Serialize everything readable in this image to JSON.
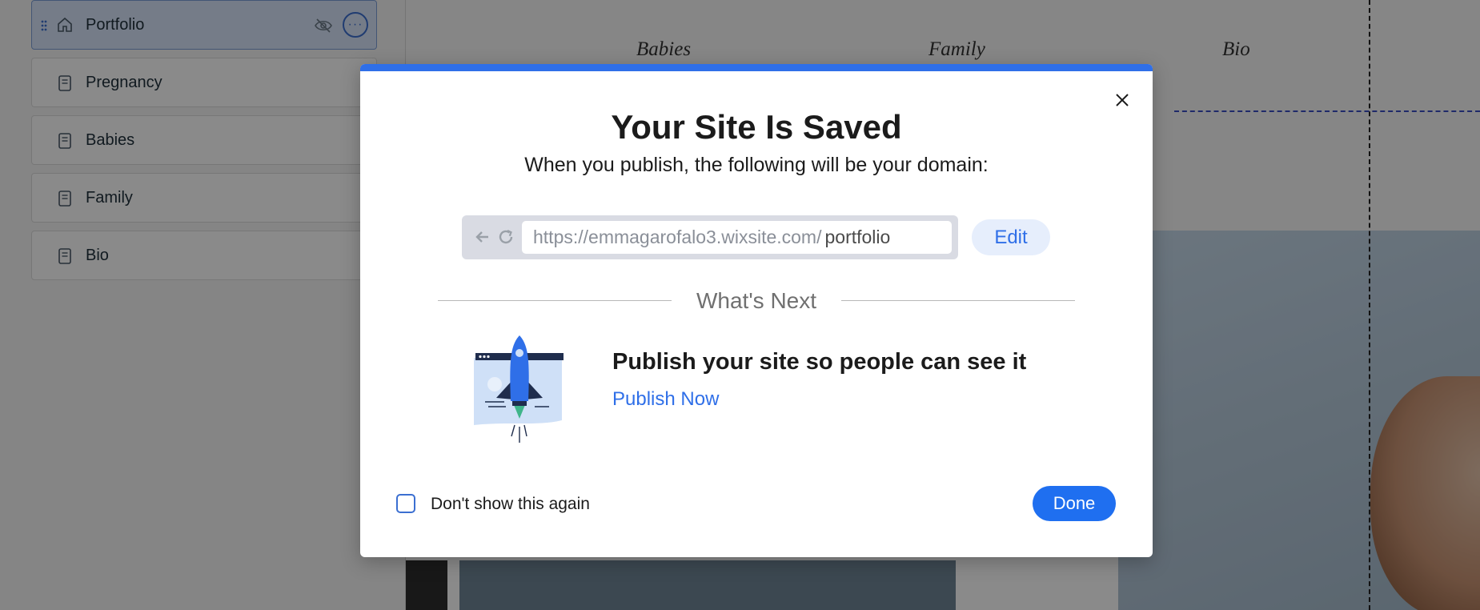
{
  "pages_panel": {
    "items": [
      {
        "label": "Portfolio",
        "icon": "home-icon",
        "active": true
      },
      {
        "label": "Pregnancy",
        "icon": "page-icon"
      },
      {
        "label": "Babies",
        "icon": "page-icon"
      },
      {
        "label": "Family",
        "icon": "page-icon"
      },
      {
        "label": "Bio",
        "icon": "page-icon"
      }
    ],
    "more_glyph": "···"
  },
  "site_nav": {
    "items": [
      "Babies",
      "Family",
      "Bio"
    ]
  },
  "modal": {
    "title": "Your Site Is Saved",
    "subtitle": "When you publish, the following will be your domain:",
    "url_base": "https://emmagarofalo3.wixsite.com/",
    "url_slug": "portfolio",
    "edit_label": "Edit",
    "whats_next_label": "What's Next",
    "publish_title": "Publish your site so people can see it",
    "publish_link": "Publish Now",
    "dont_show_label": "Don't show this again",
    "done_label": "Done"
  },
  "colors": {
    "accent": "#2f6fe8",
    "topbar": "#2f6fe8",
    "done_button": "#1f6ff0"
  }
}
